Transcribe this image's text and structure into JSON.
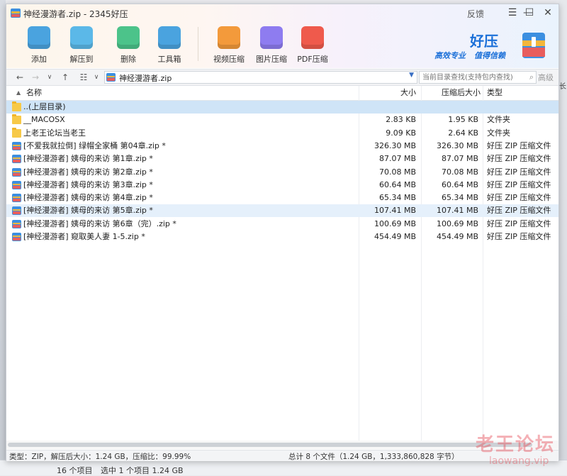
{
  "window": {
    "title": "神经漫游者.zip - 2345好压",
    "feedback": "反馈",
    "controls": {
      "menu": "☰",
      "minimize": "—",
      "maximize": "☐",
      "close": "✕"
    }
  },
  "toolbar": {
    "items": [
      {
        "label": "添加",
        "icon": "add-archive-icon",
        "color": "#4aa3df"
      },
      {
        "label": "解压到",
        "icon": "extract-icon",
        "color": "#5bb8e8"
      },
      {
        "label": "删除",
        "icon": "delete-recycle-icon",
        "color": "#4cc38a"
      },
      {
        "label": "工具箱",
        "icon": "toolbox-icon",
        "color": "#4aa3df"
      },
      {
        "label": "视频压缩",
        "icon": "video-compress-icon",
        "color": "#f39a3b"
      },
      {
        "label": "图片压缩",
        "icon": "image-compress-icon",
        "color": "#8e7cf0"
      },
      {
        "label": "PDF压缩",
        "icon": "pdf-compress-icon",
        "color": "#ef5a4c"
      }
    ]
  },
  "brand": {
    "name": "好压",
    "slogan_1": "高效专业",
    "slogan_2": "值得信赖"
  },
  "nav": {
    "back": "←",
    "forward": "→",
    "history": "∨",
    "up": "↑",
    "view": "☷",
    "view_drop": "∨",
    "path": "神经漫游者.zip",
    "search_placeholder": "当前目录查找(支持包内查找)",
    "advanced": "高级"
  },
  "list": {
    "headers": {
      "name": "名称",
      "size": "大小",
      "compressed": "压缩后大小",
      "type": "类型"
    },
    "rows": [
      {
        "name": "..(上层目录)",
        "size": "",
        "compressed": "",
        "type": "",
        "kind": "folder",
        "state": "parent"
      },
      {
        "name": "__MACOSX",
        "size": "2.83 KB",
        "compressed": "1.95 KB",
        "type": "文件夹",
        "kind": "folder",
        "state": ""
      },
      {
        "name": "上老王论坛当老王",
        "size": "9.09 KB",
        "compressed": "2.64 KB",
        "type": "文件夹",
        "kind": "folder",
        "state": ""
      },
      {
        "name": "[不爱我就拉倒] 绿帽全家桶 第04章.zip *",
        "size": "326.30 MB",
        "compressed": "326.30 MB",
        "type": "好压 ZIP 压缩文件",
        "kind": "zip",
        "state": ""
      },
      {
        "name": "[神经漫游者] 姨母的来访 第1章.zip *",
        "size": "87.07 MB",
        "compressed": "87.07 MB",
        "type": "好压 ZIP 压缩文件",
        "kind": "zip",
        "state": ""
      },
      {
        "name": "[神经漫游者] 姨母的来访 第2章.zip *",
        "size": "70.08 MB",
        "compressed": "70.08 MB",
        "type": "好压 ZIP 压缩文件",
        "kind": "zip",
        "state": ""
      },
      {
        "name": "[神经漫游者] 姨母的来访 第3章.zip *",
        "size": "60.64 MB",
        "compressed": "60.64 MB",
        "type": "好压 ZIP 压缩文件",
        "kind": "zip",
        "state": ""
      },
      {
        "name": "[神经漫游者] 姨母的来访 第4章.zip *",
        "size": "65.34 MB",
        "compressed": "65.34 MB",
        "type": "好压 ZIP 压缩文件",
        "kind": "zip",
        "state": ""
      },
      {
        "name": "[神经漫游者] 姨母的来访 第5章.zip *",
        "size": "107.41 MB",
        "compressed": "107.41 MB",
        "type": "好压 ZIP 压缩文件",
        "kind": "zip",
        "state": "hover"
      },
      {
        "name": "[神经漫游者] 姨母的来访 第6章（完）.zip *",
        "size": "100.69 MB",
        "compressed": "100.69 MB",
        "type": "好压 ZIP 压缩文件",
        "kind": "zip",
        "state": ""
      },
      {
        "name": "[神经漫游者] 窥取美人妻 1-5.zip *",
        "size": "454.49 MB",
        "compressed": "454.49 MB",
        "type": "好压 ZIP 压缩文件",
        "kind": "zip",
        "state": ""
      }
    ]
  },
  "status": {
    "left": "类型：ZIP，解压后大小：1.24 GB，压缩比：99.99%",
    "right": "总计 8 个文件（1.24 GB，1,333,860,828 字节）"
  },
  "watermark": {
    "cn": "老王论坛",
    "url": "laowang.vip"
  },
  "desktop": {
    "items_count": "16 个项目",
    "selected": "选中 1 个项目  1.24 GB",
    "right_edge": "长"
  }
}
